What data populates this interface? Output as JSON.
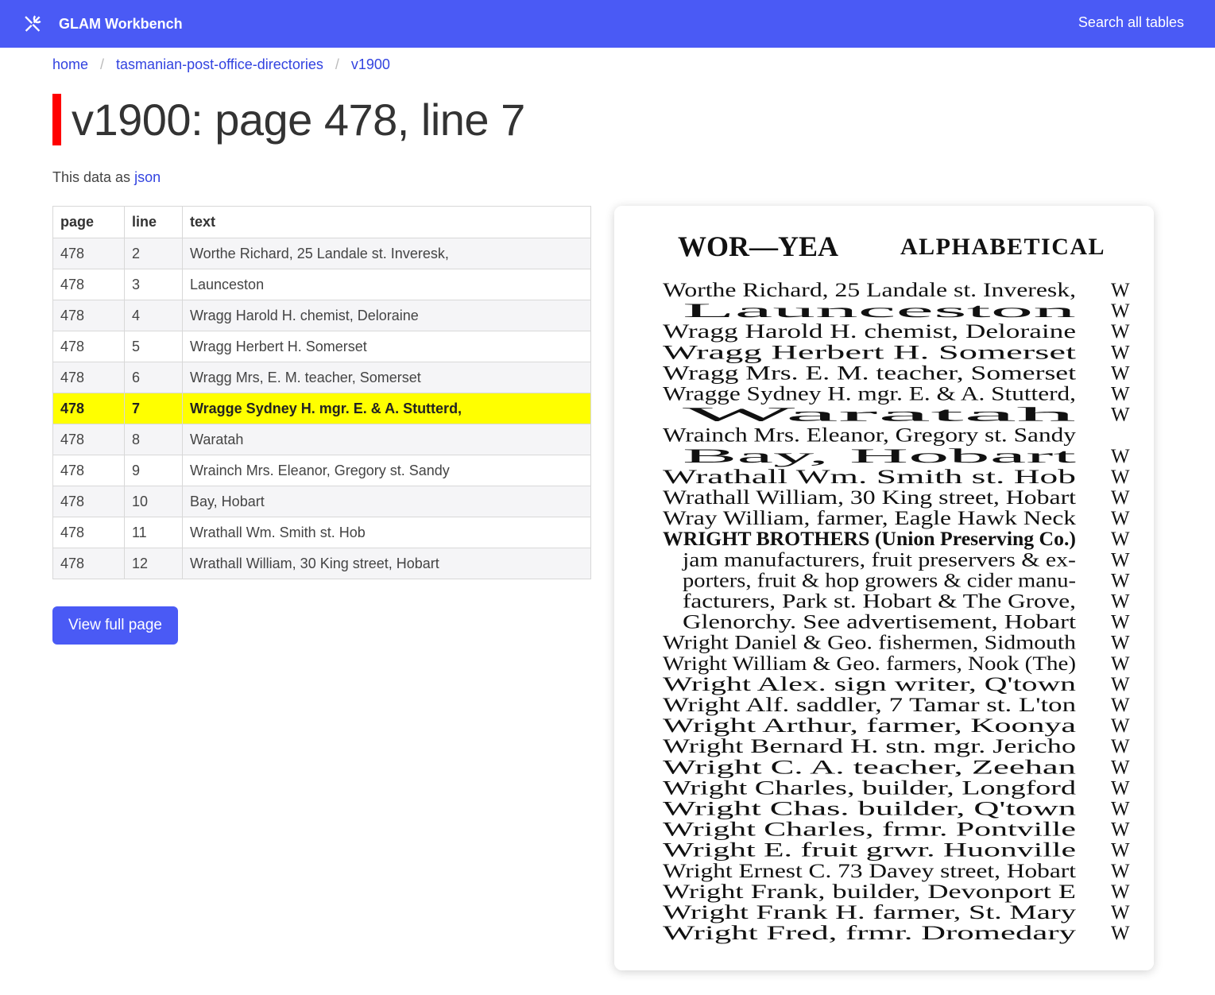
{
  "nav": {
    "title": "GLAM Workbench",
    "search_label": "Search all tables",
    "logo_icon": "tools-icon"
  },
  "breadcrumb": {
    "items": [
      "home",
      "tasmanian-post-office-directories",
      "v1900"
    ],
    "separator": "/"
  },
  "page_title": "v1900: page 478, line 7",
  "json_link": {
    "prefix": "This data as",
    "label": "json"
  },
  "table": {
    "headers": [
      "page",
      "line",
      "text"
    ],
    "rows": [
      [
        "478",
        "2",
        "Worthe Richard, 25 Landale st. Inveresk,"
      ],
      [
        "478",
        "3",
        "Launceston"
      ],
      [
        "478",
        "4",
        "Wragg Harold H. chemist, Deloraine"
      ],
      [
        "478",
        "5",
        "Wragg Herbert H. Somerset"
      ],
      [
        "478",
        "6",
        "Wragg Mrs, E. M. teacher, Somerset"
      ],
      [
        "478",
        "7",
        "Wragge Sydney H. mgr. E. & A. Stutterd,"
      ],
      [
        "478",
        "8",
        "Waratah"
      ],
      [
        "478",
        "9",
        "Wrainch Mrs. Eleanor, Gregory st. Sandy"
      ],
      [
        "478",
        "10",
        "Bay, Hobart"
      ],
      [
        "478",
        "11",
        "Wrathall Wm. Smith st. Hob"
      ],
      [
        "478",
        "12",
        "Wrathall William, 30 King street, Hobart"
      ]
    ],
    "highlight_line": "7"
  },
  "view_button": "View full page",
  "scan": {
    "header_left": "WOR—YEA",
    "header_right": "ALPHABETICAL",
    "lines": [
      "Worthe Richard, 25 Landale st. Inveresk,",
      "Launceston",
      "Wragg Harold H. chemist, Deloraine",
      "Wragg Herbert H. Somerset",
      "Wragg Mrs. E. M. teacher, Somerset",
      "Wragge Sydney H. mgr. E. & A. Stutterd,",
      "Waratah",
      "Wrainch Mrs. Eleanor, Gregory st. Sandy",
      "Bay, Hobart",
      "Wrathall Wm. Smith st. Hob",
      "Wrathall William, 30 King street, Hobart",
      "Wray William, farmer, Eagle Hawk Neck",
      "WRIGHT BROTHERS (Union Preserving Co.)",
      "jam manufacturers, fruit preservers & ex-",
      "porters, fruit & hop growers & cider manu-",
      "facturers, Park st. Hobart & The Grove,",
      "Glenorchy.   See advertisement, Hobart",
      "Wright Daniel & Geo. fishermen, Sidmouth",
      "Wright William & Geo. farmers, Nook (The)",
      "Wright Alex. sign writer, Q'town",
      "Wright Alf. saddler, 7 Tamar st. L'ton",
      "Wright Arthur, farmer, Koonya",
      "Wright Bernard H. stn. mgr. Jericho",
      "Wright C. A. teacher, Zeehan",
      "Wright Charles, builder, Longford",
      "Wright Chas. builder, Q'town",
      "Wright Charles, frmr. Pontville",
      "Wright E. fruit grwr. Huonville",
      "Wright Ernest C. 73 Davey street, Hobart",
      "Wright Frank, builder, Devonport E",
      "Wright Frank H. farmer, St. Mary",
      "Wright Fred, frmr. Dromedary"
    ],
    "indented": [
      1,
      6,
      8,
      13,
      14,
      15,
      16
    ],
    "right_col": [
      "W",
      "W",
      "W",
      "W",
      "W",
      "W",
      "W",
      "",
      "W",
      "W",
      "W",
      "W",
      "W",
      "W",
      "W",
      "W",
      "W",
      "W",
      "W",
      "W",
      "W",
      "W",
      "W",
      "W",
      "W",
      "W",
      "W",
      "W",
      "W",
      "W",
      "W",
      "W"
    ]
  },
  "colors": {
    "navbar": "#4a5af5",
    "link": "#3243e0",
    "title_bar": "#ff0000",
    "highlight": "#ffff00"
  }
}
